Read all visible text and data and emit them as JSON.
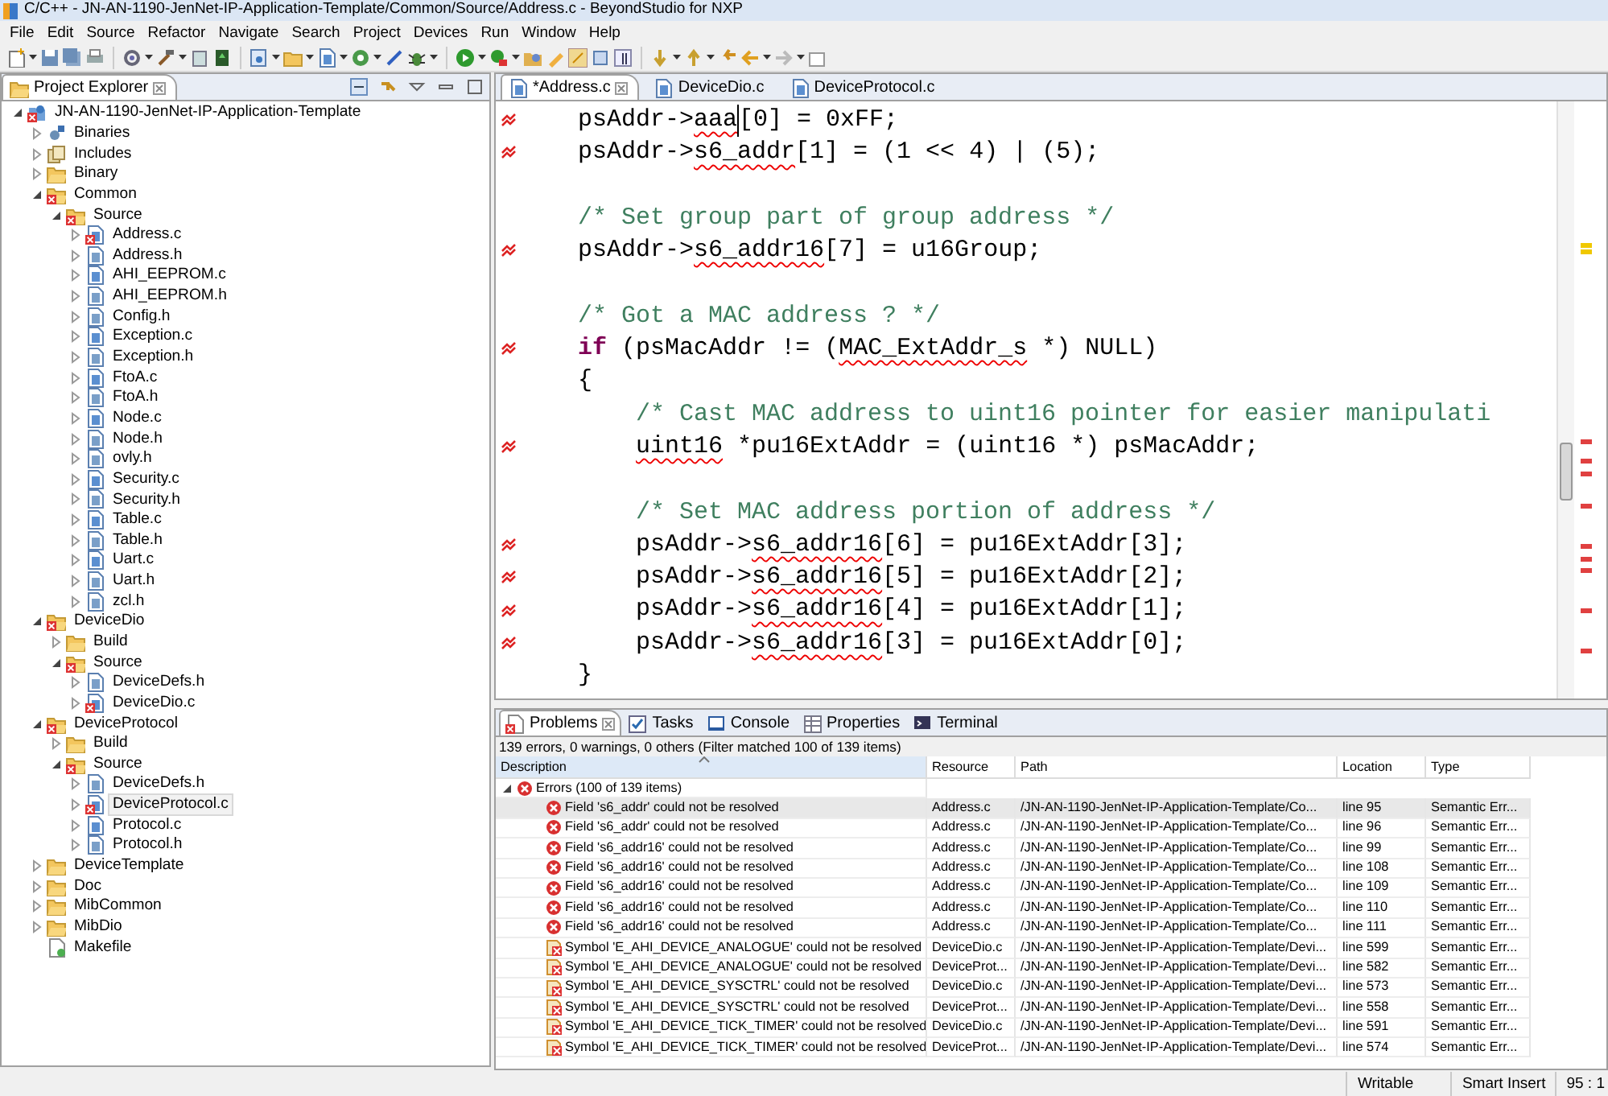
{
  "window": {
    "title": "C/C++ - JN-AN-1190-JenNet-IP-Application-Template/Common/Source/Address.c - BeyondStudio for NXP"
  },
  "menu": [
    "File",
    "Edit",
    "Source",
    "Refactor",
    "Navigate",
    "Search",
    "Project",
    "Devices",
    "Run",
    "Window",
    "Help"
  ],
  "project_explorer": {
    "title": "Project Explorer",
    "tree": [
      {
        "label": "JN-AN-1190-JenNet-IP-Application-Template",
        "kind": "project",
        "error": true,
        "expanded": true,
        "selected": false,
        "children": [
          {
            "label": "Binaries",
            "kind": "binaries",
            "error": false,
            "expanded": false,
            "selected": false
          },
          {
            "label": "Includes",
            "kind": "includes",
            "error": false,
            "expanded": false,
            "selected": false
          },
          {
            "label": "Binary",
            "kind": "folder",
            "error": false,
            "expanded": false,
            "selected": false
          },
          {
            "label": "Common",
            "kind": "folder",
            "error": true,
            "expanded": true,
            "selected": false,
            "children": [
              {
                "label": "Source",
                "kind": "folder",
                "error": true,
                "expanded": true,
                "selected": false,
                "children": [
                  {
                    "label": "Address.c",
                    "kind": "c-file",
                    "error": true,
                    "expanded": false,
                    "selected": false
                  },
                  {
                    "label": "Address.h",
                    "kind": "h-file",
                    "error": false,
                    "expanded": false,
                    "selected": false
                  },
                  {
                    "label": "AHI_EEPROM.c",
                    "kind": "c-file",
                    "error": false,
                    "expanded": false,
                    "selected": false
                  },
                  {
                    "label": "AHI_EEPROM.h",
                    "kind": "h-file",
                    "error": false,
                    "expanded": false,
                    "selected": false
                  },
                  {
                    "label": "Config.h",
                    "kind": "h-file",
                    "error": false,
                    "expanded": false,
                    "selected": false
                  },
                  {
                    "label": "Exception.c",
                    "kind": "c-file",
                    "error": false,
                    "expanded": false,
                    "selected": false
                  },
                  {
                    "label": "Exception.h",
                    "kind": "h-file",
                    "error": false,
                    "expanded": false,
                    "selected": false
                  },
                  {
                    "label": "FtoA.c",
                    "kind": "c-file",
                    "error": false,
                    "expanded": false,
                    "selected": false
                  },
                  {
                    "label": "FtoA.h",
                    "kind": "h-file",
                    "error": false,
                    "expanded": false,
                    "selected": false
                  },
                  {
                    "label": "Node.c",
                    "kind": "c-file",
                    "error": false,
                    "expanded": false,
                    "selected": false
                  },
                  {
                    "label": "Node.h",
                    "kind": "h-file",
                    "error": false,
                    "expanded": false,
                    "selected": false
                  },
                  {
                    "label": "ovly.h",
                    "kind": "h-file",
                    "error": false,
                    "expanded": false,
                    "selected": false
                  },
                  {
                    "label": "Security.c",
                    "kind": "c-file",
                    "error": false,
                    "expanded": false,
                    "selected": false
                  },
                  {
                    "label": "Security.h",
                    "kind": "h-file",
                    "error": false,
                    "expanded": false,
                    "selected": false
                  },
                  {
                    "label": "Table.c",
                    "kind": "c-file",
                    "error": false,
                    "expanded": false,
                    "selected": false
                  },
                  {
                    "label": "Table.h",
                    "kind": "h-file",
                    "error": false,
                    "expanded": false,
                    "selected": false
                  },
                  {
                    "label": "Uart.c",
                    "kind": "c-file",
                    "error": false,
                    "expanded": false,
                    "selected": false
                  },
                  {
                    "label": "Uart.h",
                    "kind": "h-file",
                    "error": false,
                    "expanded": false,
                    "selected": false
                  },
                  {
                    "label": "zcl.h",
                    "kind": "h-file",
                    "error": false,
                    "expanded": false,
                    "selected": false
                  }
                ]
              }
            ]
          },
          {
            "label": "DeviceDio",
            "kind": "folder",
            "error": true,
            "expanded": true,
            "selected": false,
            "children": [
              {
                "label": "Build",
                "kind": "folder",
                "error": false,
                "expanded": false,
                "selected": false
              },
              {
                "label": "Source",
                "kind": "folder",
                "error": true,
                "expanded": true,
                "selected": false,
                "children": [
                  {
                    "label": "DeviceDefs.h",
                    "kind": "h-file",
                    "error": false,
                    "expanded": false,
                    "selected": false
                  },
                  {
                    "label": "DeviceDio.c",
                    "kind": "c-file",
                    "error": true,
                    "expanded": false,
                    "selected": false
                  }
                ]
              }
            ]
          },
          {
            "label": "DeviceProtocol",
            "kind": "folder",
            "error": true,
            "expanded": true,
            "selected": false,
            "children": [
              {
                "label": "Build",
                "kind": "folder",
                "error": false,
                "expanded": false,
                "selected": false
              },
              {
                "label": "Source",
                "kind": "folder",
                "error": true,
                "expanded": true,
                "selected": false,
                "children": [
                  {
                    "label": "DeviceDefs.h",
                    "kind": "h-file",
                    "error": false,
                    "expanded": false,
                    "selected": false
                  },
                  {
                    "label": "DeviceProtocol.c",
                    "kind": "c-file",
                    "error": true,
                    "expanded": false,
                    "selected": true
                  },
                  {
                    "label": "Protocol.c",
                    "kind": "c-file",
                    "error": false,
                    "expanded": false,
                    "selected": false
                  },
                  {
                    "label": "Protocol.h",
                    "kind": "h-file",
                    "error": false,
                    "expanded": false,
                    "selected": false
                  }
                ]
              }
            ]
          },
          {
            "label": "DeviceTemplate",
            "kind": "folder",
            "error": false,
            "expanded": false,
            "selected": false
          },
          {
            "label": "Doc",
            "kind": "folder",
            "error": false,
            "expanded": false,
            "selected": false
          },
          {
            "label": "MibCommon",
            "kind": "folder",
            "error": false,
            "expanded": false,
            "selected": false
          },
          {
            "label": "MibDio",
            "kind": "folder",
            "error": false,
            "expanded": false,
            "selected": false
          },
          {
            "label": "Makefile",
            "kind": "makefile",
            "error": false,
            "selected": false
          }
        ]
      }
    ]
  },
  "editor": {
    "tabs": [
      {
        "label": "*Address.c",
        "selected": true
      },
      {
        "label": "DeviceDio.c",
        "selected": false
      },
      {
        "label": "DeviceProtocol.c",
        "selected": false
      }
    ],
    "lines": [
      {
        "marker": true,
        "segments": [
          {
            "kind": "plain",
            "text": "    psAddr->"
          },
          {
            "kind": "error",
            "text": "aaa"
          },
          {
            "kind": "cursor",
            "text": "[0] = 0xFF;"
          }
        ]
      },
      {
        "marker": true,
        "segments": [
          {
            "kind": "plain",
            "text": "    psAddr->"
          },
          {
            "kind": "error",
            "text": "s6_addr"
          },
          {
            "kind": "plain",
            "text": "[1] = (1 << 4) | (5);"
          }
        ]
      },
      {
        "marker": false
      },
      {
        "marker": false,
        "segments": [
          {
            "kind": "comment",
            "text": "    /* Set group part of group address */"
          }
        ]
      },
      {
        "marker": true,
        "segments": [
          {
            "kind": "plain",
            "text": "    psAddr->"
          },
          {
            "kind": "error",
            "text": "s6_addr16"
          },
          {
            "kind": "plain",
            "text": "[7] = u16Group;"
          }
        ]
      },
      {
        "marker": false
      },
      {
        "marker": false,
        "segments": [
          {
            "kind": "comment",
            "text": "    /* Got a MAC address ? */"
          }
        ]
      },
      {
        "marker": true,
        "segments": [
          {
            "kind": "keyword",
            "text": "    if"
          },
          {
            "kind": "plain",
            "text": " (psMacAddr != ("
          },
          {
            "kind": "error",
            "text": "MAC_ExtAddr_s"
          },
          {
            "kind": "plain",
            "text": " *) NULL)"
          }
        ]
      },
      {
        "marker": false,
        "segments": [
          {
            "kind": "plain",
            "text": "    {"
          }
        ]
      },
      {
        "marker": false,
        "segments": [
          {
            "kind": "comment",
            "text": "        /* Cast MAC address to uint16 pointer for easier manipulati"
          }
        ]
      },
      {
        "marker": true,
        "segments": [
          {
            "kind": "error",
            "text": "        uint16"
          },
          {
            "kind": "plain",
            "text": " *pu16ExtAddr = (uint16 *) psMacAddr;"
          }
        ]
      },
      {
        "marker": false
      },
      {
        "marker": false,
        "segments": [
          {
            "kind": "comment",
            "text": "        /* Set MAC address portion of address */"
          }
        ]
      },
      {
        "marker": true,
        "segments": [
          {
            "kind": "plain",
            "text": "        psAddr->"
          },
          {
            "kind": "error",
            "text": "s6_addr16"
          },
          {
            "kind": "plain",
            "text": "[6] = pu16ExtAddr[3];"
          }
        ]
      },
      {
        "marker": true,
        "segments": [
          {
            "kind": "plain",
            "text": "        psAddr->"
          },
          {
            "kind": "error",
            "text": "s6_addr16"
          },
          {
            "kind": "plain",
            "text": "[5] = pu16ExtAddr[2];"
          }
        ]
      },
      {
        "marker": true,
        "segments": [
          {
            "kind": "plain",
            "text": "        psAddr->"
          },
          {
            "kind": "error",
            "text": "s6_addr16"
          },
          {
            "kind": "plain",
            "text": "[4] = pu16ExtAddr[1];"
          }
        ]
      },
      {
        "marker": true,
        "segments": [
          {
            "kind": "plain",
            "text": "        psAddr->"
          },
          {
            "kind": "error",
            "text": "s6_addr16"
          },
          {
            "kind": "plain",
            "text": "[3] = pu16ExtAddr[0];"
          }
        ]
      },
      {
        "marker": false,
        "segments": [
          {
            "kind": "plain",
            "text": "    }"
          }
        ]
      }
    ]
  },
  "problems": {
    "tabs": [
      {
        "label": "Problems",
        "kind": "problems",
        "selected": true
      },
      {
        "label": "Tasks",
        "kind": "tasks",
        "selected": false
      },
      {
        "label": "Console",
        "kind": "console",
        "selected": false
      },
      {
        "label": "Properties",
        "kind": "properties",
        "selected": false
      },
      {
        "label": "Terminal",
        "kind": "terminal",
        "selected": false
      }
    ],
    "summary": "139 errors, 0 warnings, 0 others (Filter matched 100 of 139 items)",
    "columns": [
      {
        "label": "Description",
        "sorted": true
      },
      {
        "label": "Resource",
        "sorted": false
      },
      {
        "label": "Path",
        "sorted": false
      },
      {
        "label": "Location",
        "sorted": false
      },
      {
        "label": "Type",
        "sorted": false
      }
    ],
    "group": {
      "label": "Errors (100 of 139 items)",
      "expanded": true
    },
    "rows": [
      {
        "kind": "error",
        "selected": true,
        "cells": [
          "Field 's6_addr' could not be resolved",
          "Address.c",
          "/JN-AN-1190-JenNet-IP-Application-Template/Co...",
          "line 95",
          "Semantic Err..."
        ]
      },
      {
        "kind": "error",
        "selected": false,
        "cells": [
          "Field 's6_addr' could not be resolved",
          "Address.c",
          "/JN-AN-1190-JenNet-IP-Application-Template/Co...",
          "line 96",
          "Semantic Err..."
        ]
      },
      {
        "kind": "error",
        "selected": false,
        "cells": [
          "Field 's6_addr16' could not be resolved",
          "Address.c",
          "/JN-AN-1190-JenNet-IP-Application-Template/Co...",
          "line 99",
          "Semantic Err..."
        ]
      },
      {
        "kind": "error",
        "selected": false,
        "cells": [
          "Field 's6_addr16' could not be resolved",
          "Address.c",
          "/JN-AN-1190-JenNet-IP-Application-Template/Co...",
          "line 108",
          "Semantic Err..."
        ]
      },
      {
        "kind": "error",
        "selected": false,
        "cells": [
          "Field 's6_addr16' could not be resolved",
          "Address.c",
          "/JN-AN-1190-JenNet-IP-Application-Template/Co...",
          "line 109",
          "Semantic Err..."
        ]
      },
      {
        "kind": "error",
        "selected": false,
        "cells": [
          "Field 's6_addr16' could not be resolved",
          "Address.c",
          "/JN-AN-1190-JenNet-IP-Application-Template/Co...",
          "line 110",
          "Semantic Err..."
        ]
      },
      {
        "kind": "error",
        "selected": false,
        "cells": [
          "Field 's6_addr16' could not be resolved",
          "Address.c",
          "/JN-AN-1190-JenNet-IP-Application-Template/Co...",
          "line 111",
          "Semantic Err..."
        ]
      },
      {
        "kind": "symbol",
        "selected": false,
        "cells": [
          "Symbol 'E_AHI_DEVICE_ANALOGUE' could not be resolved",
          "DeviceDio.c",
          "/JN-AN-1190-JenNet-IP-Application-Template/Devi...",
          "line 599",
          "Semantic Err..."
        ]
      },
      {
        "kind": "symbol",
        "selected": false,
        "cells": [
          "Symbol 'E_AHI_DEVICE_ANALOGUE' could not be resolved",
          "DeviceProt...",
          "/JN-AN-1190-JenNet-IP-Application-Template/Devi...",
          "line 582",
          "Semantic Err..."
        ]
      },
      {
        "kind": "symbol",
        "selected": false,
        "cells": [
          "Symbol 'E_AHI_DEVICE_SYSCTRL' could not be resolved",
          "DeviceDio.c",
          "/JN-AN-1190-JenNet-IP-Application-Template/Devi...",
          "line 573",
          "Semantic Err..."
        ]
      },
      {
        "kind": "symbol",
        "selected": false,
        "cells": [
          "Symbol 'E_AHI_DEVICE_SYSCTRL' could not be resolved",
          "DeviceProt...",
          "/JN-AN-1190-JenNet-IP-Application-Template/Devi...",
          "line 558",
          "Semantic Err..."
        ]
      },
      {
        "kind": "symbol",
        "selected": false,
        "cells": [
          "Symbol 'E_AHI_DEVICE_TICK_TIMER' could not be resolved",
          "DeviceDio.c",
          "/JN-AN-1190-JenNet-IP-Application-Template/Devi...",
          "line 591",
          "Semantic Err..."
        ]
      },
      {
        "kind": "symbol",
        "selected": false,
        "cells": [
          "Symbol 'E_AHI_DEVICE_TICK_TIMER' could not be resolved",
          "DeviceProt...",
          "/JN-AN-1190-JenNet-IP-Application-Template/Devi...",
          "line 574",
          "Semantic Err..."
        ]
      }
    ]
  },
  "status_bar": [
    "Writable",
    "Smart Insert",
    "95 : 1"
  ]
}
